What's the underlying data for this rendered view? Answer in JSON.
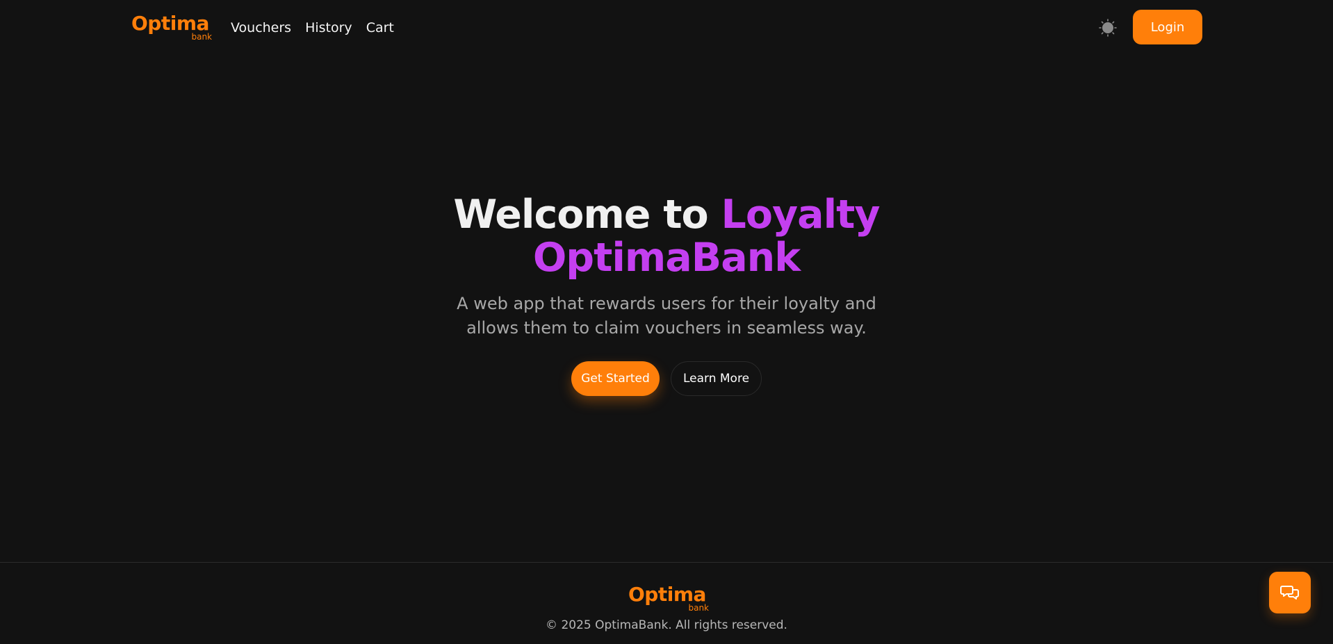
{
  "brand": {
    "name": "Optima",
    "sub": "bank",
    "color": "#ff7f0a"
  },
  "nav": {
    "items": [
      "Vouchers",
      "History",
      "Cart"
    ]
  },
  "header": {
    "theme_toggle_icon": "sun-icon",
    "login_label": "Login"
  },
  "hero": {
    "title_plain": "Welcome to ",
    "title_accent": "Loyalty OptimaBank",
    "accent_color": "#c43ff0",
    "subtitle": "A web app that rewards users for their loyalty and allows them to claim vouchers in seamless way.",
    "primary_cta": "Get Started",
    "secondary_cta": "Learn More"
  },
  "footer": {
    "brand_name": "Optima",
    "brand_sub": "bank",
    "copyright": "© 2025 OptimaBank. All rights reserved."
  },
  "chat": {
    "icon": "chat-bubbles-icon"
  }
}
